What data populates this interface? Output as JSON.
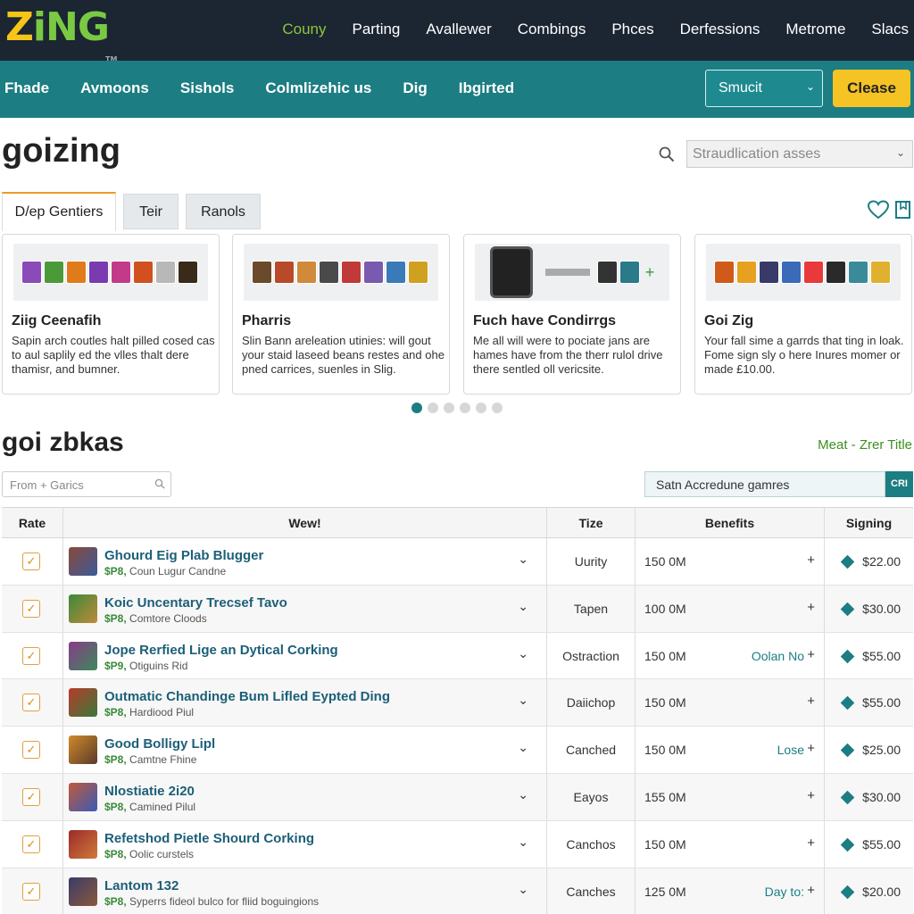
{
  "brand": {
    "logo_a": "Z",
    "logo_b": "iNG",
    "tm": "TM"
  },
  "topnav": [
    "Couny",
    "Parting",
    "Avallewer",
    "Combings",
    "Phces",
    "Derfessions",
    "Metrome",
    "Slacs"
  ],
  "nav": {
    "links": [
      "Fhade",
      "Avmoons",
      "Sishols",
      "Colmlizehic us",
      "Dig",
      "Ibgirted"
    ],
    "select_value": "Smucit",
    "close_label": "Clease"
  },
  "header": {
    "title": "goizing",
    "search_placeholder": "Straudlication asses"
  },
  "tabs": [
    "D/ep Gentiers",
    "Teir",
    "Ranols"
  ],
  "cards": [
    {
      "title": "Ziig Ceenafih",
      "desc": "Sapin arch coutles halt pilled cosed cas to aul saplily ed the vlles thalt dere thamisr, and bumner."
    },
    {
      "title": "Pharris",
      "desc": "Slin Bann areleation utinies: will gout your staid laseed beans restes and ohe pned carrices, suenles in Slig."
    },
    {
      "title": "Fuch have Condirrgs",
      "desc": "Me all will were to pociate jans are hames have from the therr rulol drive there sentled oll vericsite."
    },
    {
      "title": "Goi Zig",
      "desc": "Your fall sime a garrds that ting in loak. Fome sign sly o here Inures momer or made £10.00."
    }
  ],
  "section": {
    "title": "goi zbkas",
    "meta_link": "Meat - Zrer Title",
    "filter_placeholder": "From + Garics",
    "sort_value": "Satn Accredune gamres",
    "sort_button": "CRI"
  },
  "table": {
    "headers": [
      "Rate",
      "Wew!",
      "Tize",
      "Benefits",
      "Signing"
    ],
    "rows": [
      {
        "name": "Ghourd Eig Plab Blugger",
        "pre": "$P8,",
        "sub": "Coun Lugur Candne",
        "type": "Uurity",
        "size": "150 0M",
        "note": "",
        "price": "$22.00"
      },
      {
        "name": "Koic Uncentary Trecsef Tavo",
        "pre": "$P8,",
        "sub": "Comtore Cloods",
        "type": "Tapen",
        "size": "100 0M",
        "note": "",
        "price": "$30.00"
      },
      {
        "name": "Jope Rerfied Lige an Dytical Corking",
        "pre": "$P9,",
        "sub": "Otiguins Rid",
        "type": "Ostraction",
        "size": "150 0M",
        "note": "Oolan No",
        "price": "$55.00"
      },
      {
        "name": "Outmatic Chandinge Bum Lifled Eypted Ding",
        "pre": "$P8,",
        "sub": "Hardiood Piul",
        "type": "Daiichop",
        "size": "150 0M",
        "note": "",
        "price": "$55.00"
      },
      {
        "name": "Good Bolligy Lipl",
        "pre": "$P8,",
        "sub": "Camtne Fhine",
        "type": "Canched",
        "size": "150 0M",
        "note": "Lose",
        "price": "$25.00"
      },
      {
        "name": "Nlostiatie 2i20",
        "pre": "$P8,",
        "sub": "Camined Pilul",
        "type": "Eayos",
        "size": "155 0M",
        "note": "",
        "price": "$30.00"
      },
      {
        "name": "Refetshod Pietle Shourd Corking",
        "pre": "$P8,",
        "sub": "Oolic curstels",
        "type": "Canchos",
        "size": "150 0M",
        "note": "",
        "price": "$55.00"
      },
      {
        "name": "Lantom 132",
        "pre": "$P8,",
        "sub": "Syperrs fideol bulco for fliid boguingions",
        "type": "Canches",
        "size": "125 0M",
        "note": "Day to:",
        "price": "$20.00"
      }
    ]
  },
  "colors": {
    "topbar": "#1c2532",
    "teal": "#1c7d83",
    "accent_yellow": "#f6c324",
    "link_green": "#3d8f1f"
  }
}
